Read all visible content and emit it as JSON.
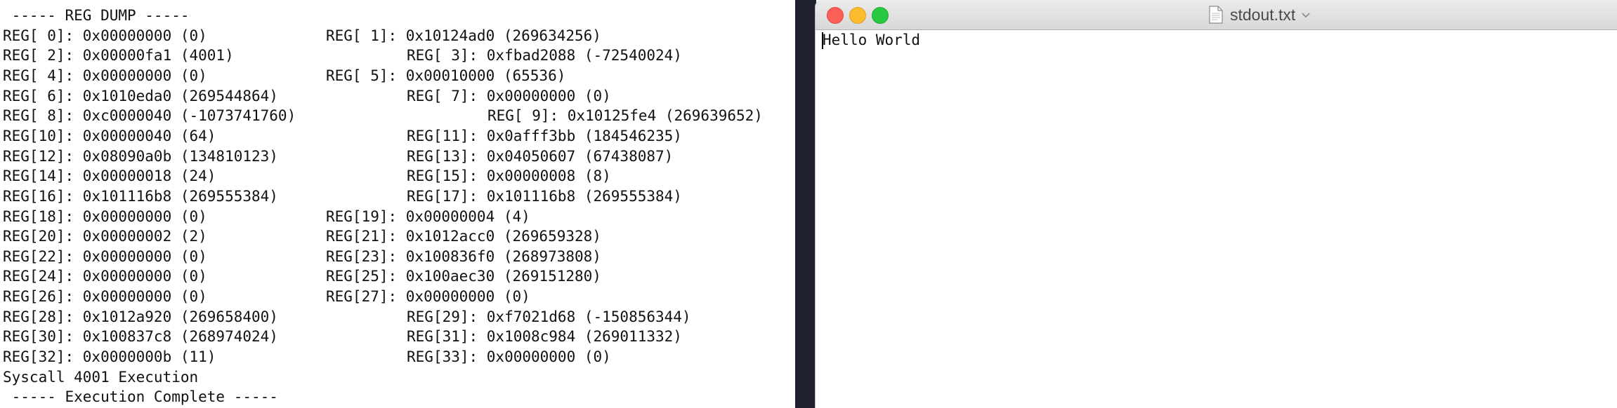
{
  "terminal": {
    "header": " ----- REG DUMP -----",
    "rows": [
      {
        "a": "REG[ 0]: 0x00000000 (0)",
        "b": "REG[ 1]: 0x10124ad0 (269634256)",
        "indent": 1
      },
      {
        "a": "REG[ 2]: 0x00000fa1 (4001)",
        "b": "REG[ 3]: 0xfbad2088 (-72540024)",
        "indent": 2
      },
      {
        "a": "REG[ 4]: 0x00000000 (0)",
        "b": "REG[ 5]: 0x00010000 (65536)",
        "indent": 1
      },
      {
        "a": "REG[ 6]: 0x1010eda0 (269544864)",
        "b": "REG[ 7]: 0x00000000 (0)",
        "indent": 2
      },
      {
        "a": "REG[ 8]: 0xc0000040 (-1073741760)",
        "b": "REG[ 9]: 0x10125fe4 (269639652)",
        "indent": 3
      },
      {
        "a": "REG[10]: 0x00000040 (64)",
        "b": "REG[11]: 0x0afff3bb (184546235)",
        "indent": 2
      },
      {
        "a": "REG[12]: 0x08090a0b (134810123)",
        "b": "REG[13]: 0x04050607 (67438087)",
        "indent": 2
      },
      {
        "a": "REG[14]: 0x00000018 (24)",
        "b": "REG[15]: 0x00000008 (8)",
        "indent": 2
      },
      {
        "a": "REG[16]: 0x101116b8 (269555384)",
        "b": "REG[17]: 0x101116b8 (269555384)",
        "indent": 2
      },
      {
        "a": "REG[18]: 0x00000000 (0)",
        "b": "REG[19]: 0x00000004 (4)",
        "indent": 1
      },
      {
        "a": "REG[20]: 0x00000002 (2)",
        "b": "REG[21]: 0x1012acc0 (269659328)",
        "indent": 1
      },
      {
        "a": "REG[22]: 0x00000000 (0)",
        "b": "REG[23]: 0x100836f0 (268973808)",
        "indent": 1
      },
      {
        "a": "REG[24]: 0x00000000 (0)",
        "b": "REG[25]: 0x100aec30 (269151280)",
        "indent": 1
      },
      {
        "a": "REG[26]: 0x00000000 (0)",
        "b": "REG[27]: 0x00000000 (0)",
        "indent": 1
      },
      {
        "a": "REG[28]: 0x1012a920 (269658400)",
        "b": "REG[29]: 0xf7021d68 (-150856344)",
        "indent": 2
      },
      {
        "a": "REG[30]: 0x100837c8 (268974024)",
        "b": "REG[31]: 0x1008c984 (269011332)",
        "indent": 2
      },
      {
        "a": "REG[32]: 0x0000000b (11)",
        "b": "REG[33]: 0x00000000 (0)",
        "indent": 2
      }
    ],
    "syscall": "Syscall 4001 Execution",
    "footer": " ----- Execution Complete -----"
  },
  "editor": {
    "title": "stdout.txt",
    "content": "Hello World",
    "icons": {
      "close": "close-icon",
      "minimize": "minimize-icon",
      "zoom": "zoom-icon",
      "document": "document-icon",
      "chevron": "chevron-down-icon"
    },
    "colors": {
      "close": "#fc5f57",
      "minimize": "#fdbc2e",
      "zoom": "#28c840"
    }
  }
}
